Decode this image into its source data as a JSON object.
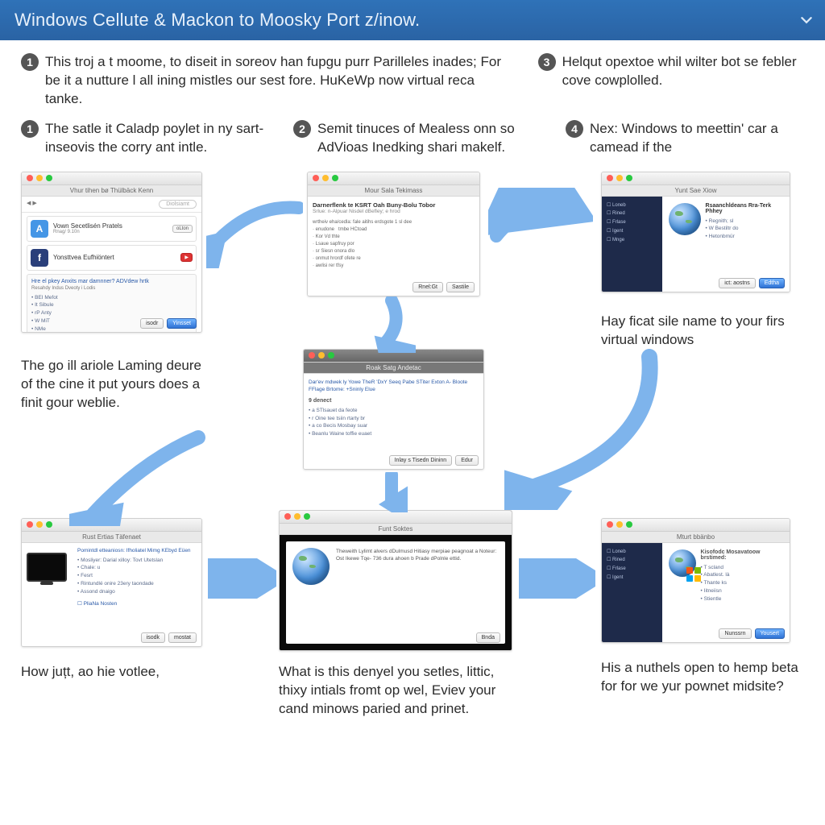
{
  "header": {
    "title": "Windows Cellute & Mackon to Moosky Port z/inow."
  },
  "intro": {
    "main_num": "1",
    "main_text": "This troj a t moome, to diseit in soreov han fupgu purr Parilleles inades; For be it a nutture l all ining mistles our sest fore. HuKeWp now virtual reca tanke.",
    "side_num": "3",
    "side_text": "Helqut opextoe whil wilter bot se febler cove cowplolled."
  },
  "steps": {
    "s1_num": "1",
    "s1_text": "The satle it Caladp poylet in ny sart-inseovis the corry ant intle.",
    "s2_num": "2",
    "s2_text": "Semit tinuces of Mealess onn so AdVioas Inedking shari makelf.",
    "s4_num": "4",
    "s4_text": "Nex: Windows to meettin' car a camead if the"
  },
  "captions": {
    "c_left_mid": "The go ill ariole Laming deure of the cine it put yours does a finit gour weblie.",
    "c_right_mid": "Hay ficat sile name to your firs virtual windows",
    "c_left_bot": "How juțt, ao hie votlee,",
    "c_mid_bot": "What is this denyel you setles, littic, thixy intials fromt op wel, Eviev your cand minows paried and prinet.",
    "c_right_bot": "His a nuthels open to hemp beta for for we yur pownet midsite?"
  },
  "shots": {
    "a": {
      "title": "Vhur tihen bø Thülbäck Kenn",
      "search_ph": "Diolsiamt",
      "tile1": "Vown Secetlisén Pratels",
      "tile1_sub": "Rnag/ 9.10n",
      "tile1_btn": "oLton",
      "tile2": "Yonsttvea Eufhiöntert",
      "panel_link": "Hre el pkey Anxits mar damnner? ADVdew hrtk",
      "b1": "BEI Mefot",
      "b2": "It Sibule",
      "b3": "rP Anty",
      "b4": "W MiT",
      "b5": "NMe",
      "btn_back": "isodr",
      "btn_next": "Yinsset"
    },
    "b": {
      "title": "Mour Sala Tekimass",
      "heading": "Darnerflenk te KSRT Oah Buny-Bolu Tobor",
      "sub": "Srlue: n-Alpuar Nisdel dBefley; e hrod",
      "btn_back": "Rnel:Gt",
      "btn_next": "Sastile"
    },
    "c": {
      "title": "Yunt Sae Xiow",
      "t1": "Rsaanchldeans Rra-Terk Phhey",
      "t2": "Regnith; sl",
      "t3": "W Bestiltr do",
      "t4": "Hetonbmür",
      "btn_back": "ict: aostns",
      "btn_next": "Edtha"
    },
    "d": {
      "title": "Roak  Satg Andetac",
      "line1": "Dar'ev mdwek ly Yowe TheR 'DxY Seeq Pabe STiter Exton A-  Bloote FFlage Brtome: +Sninly Elue",
      "heading": "9 denect",
      "b1": "a STlsauet da feote",
      "b2": "r Oine tee tsiin rtarty br",
      "b3": "a co Becis Mosbay suar",
      "b4": "Beanlu Waine toffie euaet",
      "btn_back": "Inlay s Tisedn Dininn",
      "btn_next": "Edur"
    },
    "e": {
      "title": "Rust Ertias Täfenaet",
      "link": "Pomintdl etteaniosn: Ifholiatel Mimg KEbyd Eüen",
      "b1": "Mosliyer: Darial xilloy: Tovt Utetslan",
      "b2": "Chale: u",
      "b3": "Fesrt",
      "b4": "Rintundlé onire 23ery taondade",
      "b5": "Assond dnaigo",
      "chip": "PliaNa Nosten",
      "btn_back": "isodk",
      "btn_next": "mostat"
    },
    "f": {
      "title": "Funt Soktes",
      "line": "Theweith Lylimt alvers dDulmusd Hitiasy merpiae peagnoat a Noteur: Ost Ikewe Tqe- 736 dura ahoen b Prade dPolnle ettid.",
      "btn": "Bnda"
    },
    "g": {
      "title": "Mturt bbänbo",
      "h": "Kisofodc Mosavatoow brstimed:",
      "b1": "T scland",
      "b2": "Abatlest. là",
      "b3": "Thante ks",
      "b4": "Iitneiisn",
      "b5": "Stientle",
      "btn_back": "Nunssrn",
      "btn_next": "Yousert"
    }
  }
}
